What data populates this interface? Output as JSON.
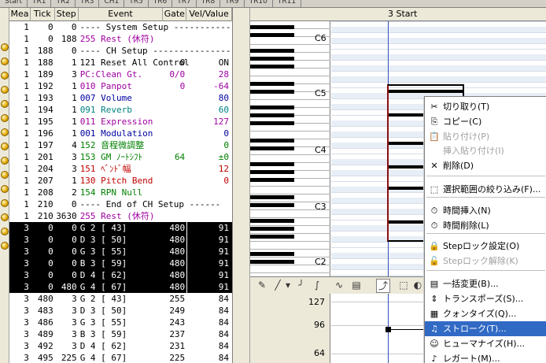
{
  "tabs": [
    "Start",
    "TR1",
    "TR2",
    "TR3",
    "CH1",
    "TR5",
    "TR6",
    "TR7",
    "TR8",
    "TR9",
    "TR10",
    "TR11"
  ],
  "list": {
    "headers": {
      "mea": "Mea",
      "tick": "Tick",
      "step": "Step",
      "event": "Event",
      "gate": "Gate",
      "vel": "Vel/Value"
    },
    "rows": [
      {
        "mea": "1",
        "tick": "0",
        "step": "0",
        "event": "---- System Setup -----------",
        "gate": "",
        "vel": "",
        "color": "#000000",
        "sel": false
      },
      {
        "mea": "1",
        "tick": "0",
        "step": "188",
        "event": "255 Rest (休符)",
        "gate": "",
        "vel": "",
        "color": "#a000a0",
        "sel": false
      },
      {
        "mea": "1",
        "tick": "188",
        "step": "0",
        "event": "---- CH Setup -----------------",
        "gate": "",
        "vel": "",
        "color": "#000000",
        "sel": false
      },
      {
        "mea": "1",
        "tick": "188",
        "step": "1",
        "event": "121 Reset All Control",
        "gate": "0",
        "vel": "ON",
        "color": "#000000",
        "sel": false
      },
      {
        "mea": "1",
        "tick": "189",
        "step": "3",
        "event": "PC:Clean Gt.",
        "gate": "0/0",
        "vel": "28",
        "color": "#a000a0",
        "sel": false
      },
      {
        "mea": "1",
        "tick": "192",
        "step": "1",
        "event": "010 Panpot",
        "gate": "0",
        "vel": "-64",
        "color": "#a000a0",
        "sel": false
      },
      {
        "mea": "1",
        "tick": "193",
        "step": "1",
        "event": "007 Volume",
        "gate": "",
        "vel": "80",
        "color": "#0000a0",
        "sel": false
      },
      {
        "mea": "1",
        "tick": "194",
        "step": "1",
        "event": "091 Reverb",
        "gate": "",
        "vel": "60",
        "color": "#008080",
        "sel": false
      },
      {
        "mea": "1",
        "tick": "195",
        "step": "1",
        "event": "011 Expression",
        "gate": "",
        "vel": "127",
        "color": "#a000a0",
        "sel": false
      },
      {
        "mea": "1",
        "tick": "196",
        "step": "1",
        "event": "001 Modulation",
        "gate": "",
        "vel": "0",
        "color": "#0000a0",
        "sel": false
      },
      {
        "mea": "1",
        "tick": "197",
        "step": "4",
        "event": "152 音程微調整",
        "gate": "",
        "vel": "0",
        "color": "#008000",
        "sel": false
      },
      {
        "mea": "1",
        "tick": "201",
        "step": "3",
        "event": "153 GM ﾉｰﾄｼﾌﾄ",
        "gate": "64",
        "vel": "±0",
        "color": "#008000",
        "sel": false
      },
      {
        "mea": "1",
        "tick": "204",
        "step": "3",
        "event": "151 ﾍﾞﾝﾄﾞ幅",
        "gate": "",
        "vel": "12",
        "color": "#c00000",
        "sel": false
      },
      {
        "mea": "1",
        "tick": "207",
        "step": "1",
        "event": "130 Pitch Bend",
        "gate": "",
        "vel": "0",
        "color": "#c00000",
        "sel": false
      },
      {
        "mea": "1",
        "tick": "208",
        "step": "2",
        "event": "154 RPN Null",
        "gate": "",
        "vel": "",
        "color": "#008000",
        "sel": false
      },
      {
        "mea": "1",
        "tick": "210",
        "step": "0",
        "event": "---- End of CH Setup ------",
        "gate": "",
        "vel": "",
        "color": "#000000",
        "sel": false
      },
      {
        "mea": "1",
        "tick": "210",
        "step": "3630",
        "event": "255 Rest (休符)",
        "gate": "",
        "vel": "",
        "color": "#a000a0",
        "sel": false
      },
      {
        "mea": "3",
        "tick": "0",
        "step": "0",
        "event": "G 2 [ 43]",
        "gate": "480",
        "vel": "91",
        "color": "#ffffff",
        "sel": true
      },
      {
        "mea": "3",
        "tick": "0",
        "step": "0",
        "event": "D 3 [ 50]",
        "gate": "480",
        "vel": "91",
        "color": "#ffffff",
        "sel": true
      },
      {
        "mea": "3",
        "tick": "0",
        "step": "0",
        "event": "G 3 [ 55]",
        "gate": "480",
        "vel": "91",
        "color": "#ffffff",
        "sel": true
      },
      {
        "mea": "3",
        "tick": "0",
        "step": "0",
        "event": "B 3 [ 59]",
        "gate": "480",
        "vel": "91",
        "color": "#ffffff",
        "sel": true
      },
      {
        "mea": "3",
        "tick": "0",
        "step": "0",
        "event": "D 4 [ 62]",
        "gate": "480",
        "vel": "91",
        "color": "#ffffff",
        "sel": true
      },
      {
        "mea": "3",
        "tick": "0",
        "step": "480",
        "event": "G 4 [ 67]",
        "gate": "480",
        "vel": "91",
        "color": "#ffffff",
        "sel": true
      },
      {
        "mea": "3",
        "tick": "480",
        "step": "3",
        "event": "G 2 [ 43]",
        "gate": "255",
        "vel": "84",
        "color": "#000000",
        "sel": false
      },
      {
        "mea": "3",
        "tick": "483",
        "step": "3",
        "event": "D 3 [ 50]",
        "gate": "249",
        "vel": "84",
        "color": "#000000",
        "sel": false
      },
      {
        "mea": "3",
        "tick": "486",
        "step": "3",
        "event": "G 3 [ 55]",
        "gate": "243",
        "vel": "84",
        "color": "#000000",
        "sel": false
      },
      {
        "mea": "3",
        "tick": "489",
        "step": "3",
        "event": "B 3 [ 59]",
        "gate": "237",
        "vel": "84",
        "color": "#000000",
        "sel": false
      },
      {
        "mea": "3",
        "tick": "492",
        "step": "3",
        "event": "D 4 [ 62]",
        "gate": "231",
        "vel": "84",
        "color": "#000000",
        "sel": false
      },
      {
        "mea": "3",
        "tick": "495",
        "step": "225",
        "event": "G 4 [ 67]",
        "gate": "225",
        "vel": "84",
        "color": "#000000",
        "sel": false
      }
    ]
  },
  "pianoroll": {
    "ruler_label": "3 Start",
    "octave_labels": [
      "C6",
      "C5",
      "C4",
      "C3",
      "C2"
    ]
  },
  "velocity": {
    "ticks": [
      "127",
      "96",
      "64"
    ]
  },
  "menu": {
    "items": [
      {
        "label": "切り取り(T)",
        "icon": "✂",
        "icon_name": "scissors-icon",
        "disabled": false,
        "highlight": false
      },
      {
        "label": "コピー(C)",
        "icon": "⎘",
        "icon_name": "copy-icon",
        "disabled": false,
        "highlight": false
      },
      {
        "label": "貼り付け(P)",
        "icon": "📋",
        "icon_name": "paste-icon",
        "disabled": true,
        "highlight": false
      },
      {
        "label": "挿入貼り付け(I)",
        "icon": "",
        "icon_name": "",
        "disabled": true,
        "highlight": false
      },
      {
        "label": "削除(D)",
        "icon": "✕",
        "icon_name": "delete-icon",
        "disabled": false,
        "highlight": false
      },
      {
        "label": "選択範囲の絞り込み(F)...",
        "icon": "⬚",
        "icon_name": "filter-selection-icon",
        "disabled": false,
        "highlight": false
      },
      {
        "label": "時間挿入(N)",
        "icon": "⏱",
        "icon_name": "time-insert-icon",
        "disabled": false,
        "highlight": false
      },
      {
        "label": "時間削除(L)",
        "icon": "⏱",
        "icon_name": "time-delete-icon",
        "disabled": false,
        "highlight": false
      },
      {
        "label": "Stepロック設定(O)",
        "icon": "🔒",
        "icon_name": "step-lock-icon",
        "disabled": false,
        "highlight": false
      },
      {
        "label": "Stepロック解除(K)",
        "icon": "🔓",
        "icon_name": "step-unlock-icon",
        "disabled": true,
        "highlight": false
      },
      {
        "label": "一括変更(B)...",
        "icon": "▤",
        "icon_name": "batch-change-icon",
        "disabled": false,
        "highlight": false
      },
      {
        "label": "トランスポーズ(S)...",
        "icon": "⇕",
        "icon_name": "transpose-icon",
        "disabled": false,
        "highlight": false
      },
      {
        "label": "クォンタイズ(Q)...",
        "icon": "▦",
        "icon_name": "quantize-icon",
        "disabled": false,
        "highlight": false
      },
      {
        "label": "ストローク(T)...",
        "icon": "♫",
        "icon_name": "stroke-icon",
        "disabled": false,
        "highlight": true
      },
      {
        "label": "ヒューマナイズ(H)...",
        "icon": "☺",
        "icon_name": "humanize-icon",
        "disabled": false,
        "highlight": false
      },
      {
        "label": "レガート(M)...",
        "icon": "♪",
        "icon_name": "legato-icon",
        "disabled": false,
        "highlight": false
      }
    ]
  }
}
